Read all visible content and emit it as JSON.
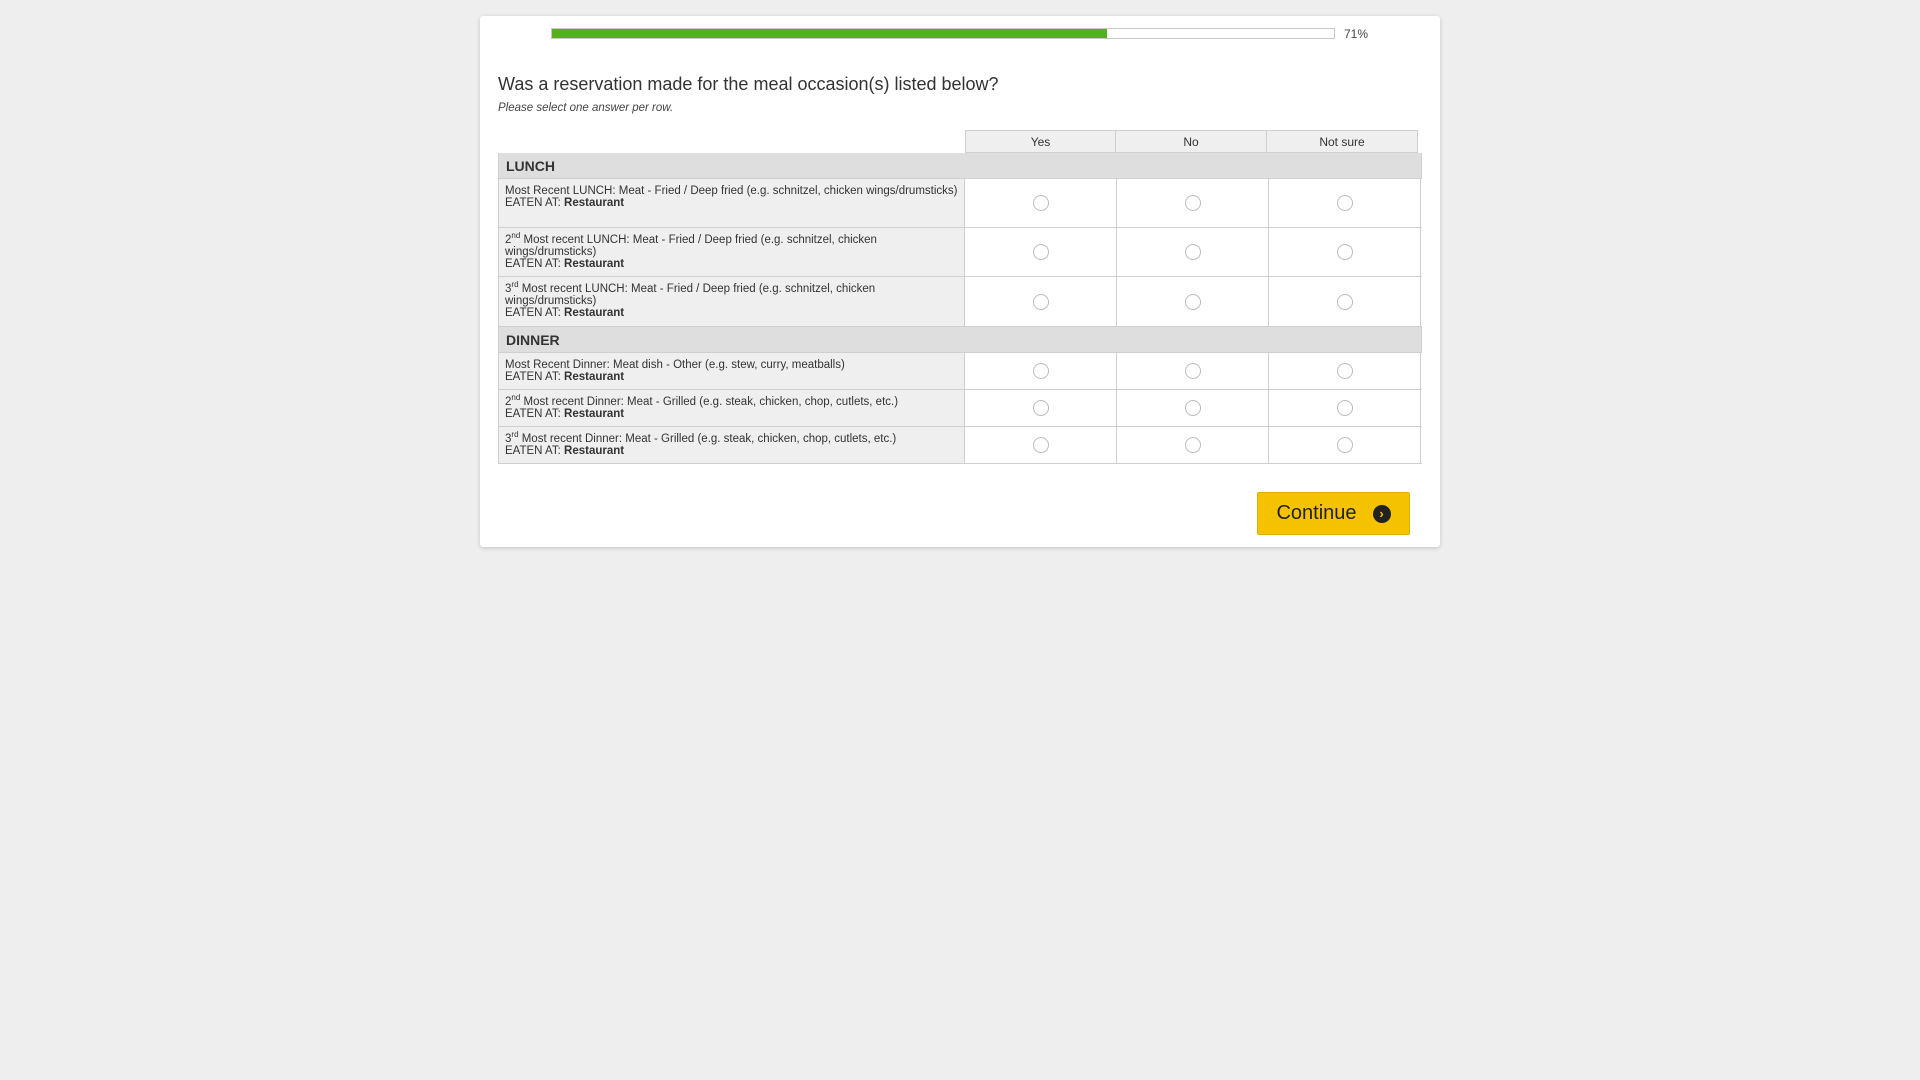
{
  "progress": {
    "percent_text": "71%",
    "fraction": 0.71
  },
  "question": {
    "text": "Was a reservation made for the meal occasion(s) listed below?",
    "instruction": "Please select one answer per row."
  },
  "columns": [
    "Yes",
    "No",
    "Not sure"
  ],
  "sections": [
    {
      "title": "LUNCH",
      "items": [
        {
          "ordinal": "",
          "ordinal_suffix": "",
          "text": "Most Recent LUNCH: Meat - Fried / Deep fried (e.g. schnitzel, chicken wings/drumsticks)",
          "eaten_label": "EATEN AT:",
          "eaten_value": "Restaurant"
        },
        {
          "ordinal": "2",
          "ordinal_suffix": "nd",
          "text": " Most recent LUNCH: Meat - Fried / Deep fried (e.g. schnitzel, chicken wings/drumsticks)",
          "eaten_label": "EATEN AT:",
          "eaten_value": "Restaurant"
        },
        {
          "ordinal": "3",
          "ordinal_suffix": "rd",
          "text": " Most recent LUNCH: Meat - Fried / Deep fried (e.g. schnitzel, chicken wings/drumsticks)",
          "eaten_label": "EATEN AT:",
          "eaten_value": "Restaurant"
        }
      ]
    },
    {
      "title": "DINNER",
      "items": [
        {
          "ordinal": "",
          "ordinal_suffix": "",
          "text": "Most Recent Dinner: Meat dish - Other (e.g. stew, curry, meatballs)",
          "eaten_label": "EATEN AT:",
          "eaten_value": "Restaurant"
        },
        {
          "ordinal": "2",
          "ordinal_suffix": "nd",
          "text": " Most recent Dinner: Meat - Grilled (e.g. steak, chicken, chop, cutlets, etc.)",
          "eaten_label": "EATEN AT:",
          "eaten_value": "Restaurant"
        },
        {
          "ordinal": "3",
          "ordinal_suffix": "rd",
          "text": " Most recent Dinner: Meat - Grilled (e.g. steak, chicken, chop, cutlets, etc.)",
          "eaten_label": "EATEN AT:",
          "eaten_value": "Restaurant"
        }
      ]
    }
  ],
  "continue_button": {
    "label": "Continue",
    "icon": "chevron-right-circle-icon"
  },
  "colors": {
    "progress": "#55b01c",
    "button": "#f5c200",
    "background": "#eeeeee"
  }
}
